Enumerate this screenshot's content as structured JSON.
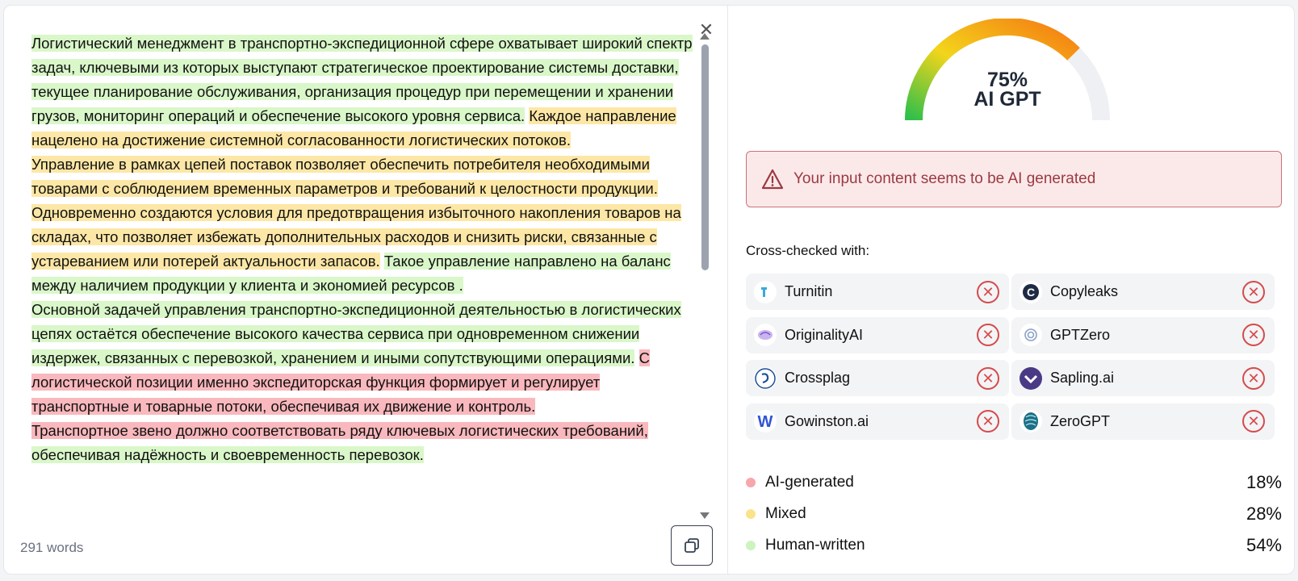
{
  "editor": {
    "paragraphs": [
      [
        {
          "hl": "g",
          "text": "Логистический менеджмент в транспортно-экспедиционной сфере охватывает широкий спектр задач, ключевыми из которых выступают стратегическое проектирование системы доставки, текущее планирование обслуживания, организация процедур при перемещении и хранении грузов, мониторинг операций и обеспечение высокого уровня сервиса."
        },
        {
          "hl": "",
          "text": " "
        },
        {
          "hl": "y",
          "text": "Каждое направление нацелено на достижение системной согласованности логистических потоков."
        }
      ],
      [
        {
          "hl": "y",
          "text": "Управление в рамках цепей поставок позволяет обеспечить потребителя необходимыми товарами с соблюдением временных параметров и требований к целостности продукции. Одновременно создаются условия для предотвращения избыточного накопления товаров на складах, что позволяет избежать дополнительных расходов и снизить риски, связанные с устареванием или потерей актуальности запасов."
        },
        {
          "hl": "",
          "text": " "
        },
        {
          "hl": "g",
          "text": "Такое управление направлено на баланс между наличием продукции у клиента и экономией ресурсов ."
        }
      ],
      [
        {
          "hl": "g",
          "text": "Основной задачей управления транспортно-экспедиционной деятельностью в логистических цепях остаётся обеспечение высокого качества сервиса при одновременном снижении издержек, связанных с перевозкой, хранением и иными сопутствующими операциями."
        },
        {
          "hl": "",
          "text": " "
        },
        {
          "hl": "r",
          "text": "С логистической позиции именно экспедиторская функция формирует и регулирует транспортные и товарные потоки, обеспечивая их движение и контроль."
        }
      ],
      [
        {
          "hl": "r",
          "text": "Транспортное звено должно соответствовать ряду ключевых логистических требований,"
        },
        {
          "hl": "g",
          "text": " обеспечивая надёжность и своевременность перевозок."
        }
      ]
    ],
    "word_count": "291 words"
  },
  "gauge": {
    "value": 75,
    "percent_label": "75%",
    "label": "AI GPT"
  },
  "alert": {
    "text": "Your input content seems to be AI generated"
  },
  "cross_check": {
    "title": "Cross-checked with:",
    "tools": [
      {
        "name": "Turnitin",
        "icon": "turnitin-icon"
      },
      {
        "name": "Copyleaks",
        "icon": "copyleaks-icon"
      },
      {
        "name": "OriginalityAI",
        "icon": "originalityai-icon"
      },
      {
        "name": "GPTZero",
        "icon": "gptzero-icon"
      },
      {
        "name": "Crossplag",
        "icon": "crossplag-icon"
      },
      {
        "name": "Sapling.ai",
        "icon": "sapling-icon"
      },
      {
        "name": "Gowinston.ai",
        "icon": "gowinston-icon"
      },
      {
        "name": "ZeroGPT",
        "icon": "zerogpt-icon"
      }
    ],
    "status_icon": "x-circle-icon"
  },
  "legend": [
    {
      "label": "AI-generated",
      "value": "18%",
      "color": "#f7a6ab"
    },
    {
      "label": "Mixed",
      "value": "28%",
      "color": "#fbe38a"
    },
    {
      "label": "Human-written",
      "value": "54%",
      "color": "#cdf3bf"
    }
  ]
}
